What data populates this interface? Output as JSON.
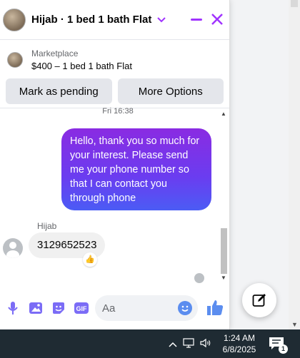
{
  "header": {
    "title": "Hijab · 1 bed 1 bath Flat"
  },
  "listing": {
    "label": "Marketplace",
    "price_title": "$400 – 1 bed 1 bath Flat",
    "buttons": {
      "pending": "Mark as pending",
      "more": "More Options"
    }
  },
  "conversation": {
    "timestamp": "Fri 16:38",
    "outgoing": "Hello, thank you so much for your interest. Please send me your phone number so that I can contact you through phone",
    "sender": "Hijab",
    "incoming": "3129652523",
    "reaction": "👍"
  },
  "composer": {
    "placeholder": "Aa",
    "gif": "GIF"
  },
  "taskbar": {
    "time": "1:24 AM",
    "date": "6/8/2025",
    "notifications": "1"
  },
  "colors": {
    "accent": "#a033ff",
    "bubble_start": "#8a2be2",
    "bubble_end": "#4b5cf5"
  }
}
